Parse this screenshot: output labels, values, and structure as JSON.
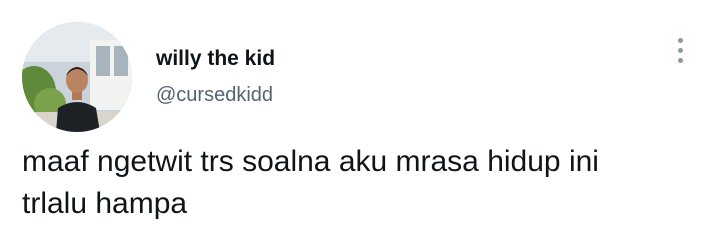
{
  "tweet": {
    "author": {
      "display_name": "willy the kid",
      "handle": "@cursedkidd",
      "avatar": "profile-photo"
    },
    "text": "maaf ngetwit trs soalna aku mrasa hidup ini trlalu hampa",
    "menu_icon": "more-vertical-icon"
  },
  "colors": {
    "text_primary": "#0f1419",
    "text_secondary": "#536471",
    "background": "#ffffff"
  }
}
